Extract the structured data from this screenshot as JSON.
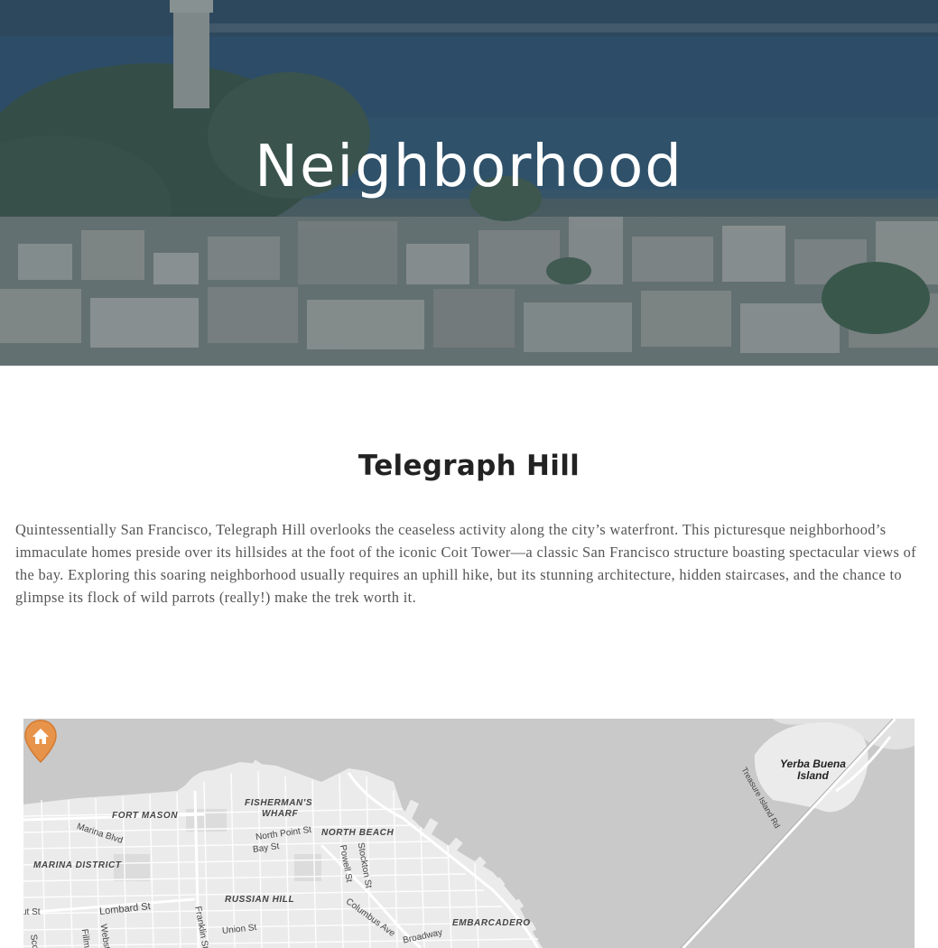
{
  "hero": {
    "title": "Neighborhood"
  },
  "section": {
    "title": "Telegraph Hill",
    "description": "Quintessentially San Francisco, Telegraph Hill overlooks the ceaseless activity along the city’s waterfront. This picturesque neighborhood’s immaculate homes preside over its hillsides at the foot of the iconic Coit Tower—a classic San Francisco structure boasting spectacular views of the bay. Exploring this soaring neighborhood usually requires an uphill hike, but its stunning architecture, hidden staircases, and the chance to glimpse its flock of wild parrots (really!) make the trek worth it."
  },
  "map": {
    "districts": {
      "fort_mason": "FORT MASON",
      "fishermans_wharf_1": "FISHERMAN'S",
      "fishermans_wharf_2": "WHARF",
      "north_beach": "NORTH BEACH",
      "marina_district": "MARINA DISTRICT",
      "russian_hill": "RUSSIAN HILL",
      "embarcadero": "EMBARCADERO"
    },
    "streets": {
      "marina_blvd": "Marina Blvd",
      "north_point_st": "North Point St",
      "bay_st": "Bay St",
      "powell_st": "Powell St",
      "stockton_st": "Stockton St",
      "lombard_st": "Lombard St",
      "union_st": "Union St",
      "columbus_ave": "Columbus Ave",
      "broadway": "Broadway",
      "franklin_st": "Franklin St",
      "webster_st": "Webst",
      "fillmore_st": "Fillm",
      "scott_st": "Sco",
      "chestnut_st": "ut St",
      "treasure_island_rd": "Treasure Island Rd"
    },
    "islands": {
      "yerba_buena_1": "Yerba Buena",
      "yerba_buena_2": "Island"
    },
    "colors": {
      "water": "#c9c9c9",
      "land": "#ebebeb",
      "road": "#ffffff",
      "marker": "#e8934a"
    },
    "marker_icon": "home-icon"
  }
}
